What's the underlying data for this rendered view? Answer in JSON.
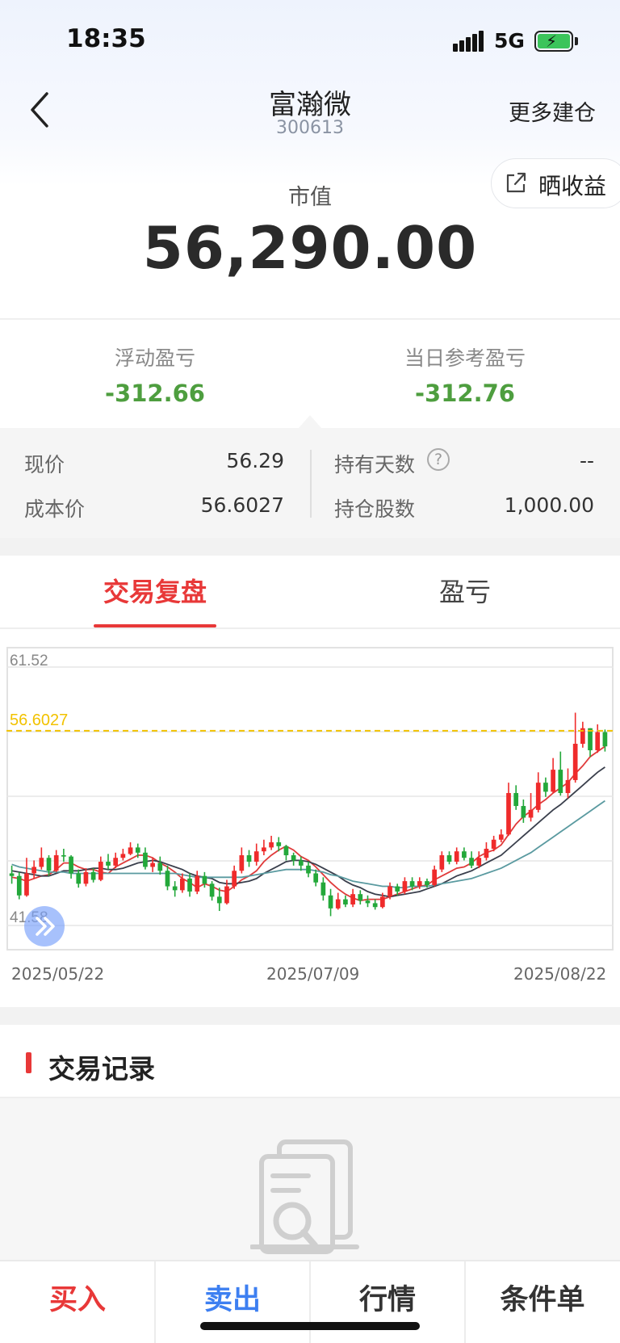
{
  "status_bar": {
    "time": "18:35",
    "network": "5G"
  },
  "nav": {
    "title": "富瀚微",
    "code": "300613",
    "more_label": "更多建仓"
  },
  "share": {
    "label": "晒收益"
  },
  "market_value": {
    "label": "市值",
    "value": "56,290.00"
  },
  "pnl": {
    "floating_label": "浮动盈亏",
    "floating_value": "-312.66",
    "daily_label": "当日参考盈亏",
    "daily_value": "-312.76"
  },
  "details": {
    "current_price_label": "现价",
    "current_price": "56.29",
    "cost_price_label": "成本价",
    "cost_price": "56.6027",
    "holding_days_label": "持有天数",
    "holding_days": "--",
    "shares_label": "持仓股数",
    "shares": "1,000.00"
  },
  "tabs": [
    {
      "label": "交易复盘",
      "active": true
    },
    {
      "label": "盈亏",
      "active": false
    }
  ],
  "chart_data": {
    "type": "candlestick",
    "y_max_label": "61.52",
    "y_min_label": "41.58",
    "ylim": [
      41.58,
      61.52
    ],
    "cost_line": {
      "value": 56.6027,
      "label": "56.6027",
      "color": "#f2c200"
    },
    "x_tick_labels": [
      "2025/05/22",
      "2025/07/09",
      "2025/08/22"
    ],
    "up_color": "#ef2b2b",
    "down_color": "#23a83a",
    "ohlc": [
      [
        45.6,
        45.4,
        46.2,
        44.8
      ],
      [
        45.4,
        43.9,
        45.7,
        43.6
      ],
      [
        43.9,
        45.6,
        46.8,
        43.8
      ],
      [
        45.6,
        46.1,
        46.6,
        45.2
      ],
      [
        46.1,
        46.8,
        47.6,
        45.9
      ],
      [
        46.8,
        45.8,
        47.0,
        45.4
      ],
      [
        45.8,
        47.0,
        47.4,
        45.7
      ],
      [
        47.0,
        46.9,
        47.5,
        46.5
      ],
      [
        46.9,
        45.6,
        47.0,
        45.2
      ],
      [
        45.6,
        44.8,
        45.9,
        44.5
      ],
      [
        44.8,
        45.7,
        46.0,
        44.6
      ],
      [
        45.7,
        45.1,
        46.0,
        44.9
      ],
      [
        45.1,
        46.5,
        46.9,
        45.0
      ],
      [
        46.5,
        46.2,
        47.1,
        45.9
      ],
      [
        46.2,
        46.8,
        47.2,
        46.0
      ],
      [
        46.8,
        47.1,
        47.5,
        46.6
      ],
      [
        47.1,
        47.6,
        48.0,
        47.0
      ],
      [
        47.6,
        47.2,
        47.9,
        46.8
      ],
      [
        47.2,
        46.1,
        47.6,
        45.9
      ],
      [
        46.1,
        46.4,
        46.8,
        45.7
      ],
      [
        46.4,
        45.8,
        46.9,
        45.5
      ],
      [
        45.8,
        44.6,
        46.2,
        44.3
      ],
      [
        44.6,
        44.3,
        45.0,
        43.8
      ],
      [
        44.3,
        45.2,
        45.6,
        44.1
      ],
      [
        45.2,
        44.2,
        45.6,
        43.8
      ],
      [
        44.2,
        45.4,
        45.8,
        44.0
      ],
      [
        45.4,
        44.8,
        45.7,
        44.5
      ],
      [
        44.8,
        43.8,
        45.0,
        43.5
      ],
      [
        43.8,
        43.3,
        44.5,
        42.7
      ],
      [
        43.3,
        44.6,
        45.1,
        43.2
      ],
      [
        44.6,
        45.8,
        46.2,
        44.4
      ],
      [
        45.8,
        47.0,
        47.6,
        45.6
      ],
      [
        47.0,
        46.5,
        47.4,
        46.1
      ],
      [
        46.5,
        47.3,
        47.9,
        46.2
      ],
      [
        47.3,
        47.6,
        48.2,
        47.0
      ],
      [
        47.6,
        48.0,
        48.5,
        47.4
      ],
      [
        48.0,
        47.7,
        48.4,
        47.3
      ],
      [
        47.7,
        47.0,
        47.8,
        46.6
      ],
      [
        47.0,
        46.6,
        47.2,
        46.2
      ],
      [
        46.6,
        46.2,
        46.9,
        45.8
      ],
      [
        46.2,
        45.6,
        46.5,
        45.3
      ],
      [
        45.6,
        44.9,
        45.9,
        44.6
      ],
      [
        44.9,
        43.9,
        45.3,
        43.5
      ],
      [
        43.9,
        42.9,
        44.4,
        42.3
      ],
      [
        42.9,
        43.6,
        44.1,
        42.8
      ],
      [
        43.6,
        43.2,
        43.9,
        43.0
      ],
      [
        43.2,
        44.0,
        44.4,
        43.0
      ],
      [
        44.0,
        43.5,
        44.3,
        43.2
      ],
      [
        43.5,
        43.3,
        43.9,
        43.0
      ],
      [
        43.3,
        43.0,
        43.6,
        42.8
      ],
      [
        43.0,
        43.8,
        44.1,
        42.9
      ],
      [
        43.8,
        44.6,
        44.9,
        43.6
      ],
      [
        44.6,
        44.2,
        44.8,
        43.9
      ],
      [
        44.2,
        45.0,
        45.3,
        44.0
      ],
      [
        45.0,
        44.6,
        45.3,
        44.3
      ],
      [
        44.6,
        45.0,
        45.3,
        44.4
      ],
      [
        45.0,
        44.7,
        45.2,
        44.5
      ],
      [
        44.7,
        45.9,
        46.2,
        44.6
      ],
      [
        45.9,
        47.0,
        47.3,
        45.7
      ],
      [
        47.0,
        46.5,
        47.3,
        46.3
      ],
      [
        46.5,
        47.3,
        47.6,
        46.3
      ],
      [
        47.3,
        46.8,
        47.6,
        46.6
      ],
      [
        46.8,
        46.2,
        47.3,
        46.0
      ],
      [
        46.2,
        46.8,
        47.3,
        46.0
      ],
      [
        46.8,
        47.5,
        48.0,
        46.6
      ],
      [
        47.5,
        48.2,
        48.5,
        47.3
      ],
      [
        48.2,
        48.6,
        49.0,
        48.0
      ],
      [
        48.6,
        51.8,
        52.6,
        48.5
      ],
      [
        51.8,
        50.8,
        52.4,
        50.5
      ],
      [
        50.8,
        49.9,
        51.3,
        49.5
      ],
      [
        49.9,
        50.5,
        51.8,
        49.6
      ],
      [
        50.5,
        52.6,
        53.4,
        50.3
      ],
      [
        52.6,
        51.9,
        53.0,
        51.5
      ],
      [
        51.9,
        53.6,
        54.5,
        51.8
      ],
      [
        53.6,
        51.8,
        55.0,
        51.6
      ],
      [
        51.8,
        52.8,
        53.7,
        51.4
      ],
      [
        52.8,
        55.6,
        58.0,
        52.6
      ],
      [
        55.6,
        56.8,
        57.3,
        55.3
      ],
      [
        56.8,
        55.1,
        56.8,
        54.6
      ],
      [
        55.1,
        56.5,
        57.1,
        54.9
      ],
      [
        56.5,
        55.4,
        56.7,
        55.0
      ]
    ],
    "ma": [
      {
        "color": "#e03b3b",
        "values": [
          45.3,
          45.2,
          45.0,
          45.2,
          45.4,
          45.5,
          45.9,
          46.4,
          46.4,
          46.1,
          45.9,
          45.9,
          45.7,
          45.6,
          46.1,
          46.4,
          46.7,
          47.0,
          47.0,
          46.8,
          46.4,
          46.1,
          45.7,
          45.2,
          44.9,
          44.5,
          44.8,
          44.6,
          44.3,
          44.2,
          44.6,
          45.1,
          45.4,
          45.8,
          46.5,
          47.0,
          47.4,
          47.7,
          47.4,
          46.9,
          46.6,
          46.1,
          45.5,
          44.9,
          44.4,
          44.0,
          43.7,
          43.5,
          43.6,
          43.6,
          43.6,
          43.8,
          44.0,
          44.2,
          44.4,
          44.6,
          44.7,
          45.1,
          45.4,
          45.7,
          46.0,
          46.1,
          46.4,
          46.9,
          47.2,
          47.4,
          47.8,
          48.6,
          49.4,
          50.0,
          50.4,
          50.9,
          51.3,
          51.8,
          52.2,
          52.6,
          53.3,
          53.9,
          54.6,
          55.0,
          55.4
        ]
      },
      {
        "color": "#3a3f4c",
        "values": [
          45.8,
          45.7,
          45.6,
          45.5,
          45.4,
          45.4,
          45.6,
          45.8,
          45.8,
          45.8,
          45.9,
          46.0,
          46.0,
          45.9,
          45.9,
          46.0,
          46.2,
          46.4,
          46.5,
          46.6,
          46.5,
          46.3,
          46.1,
          45.9,
          45.6,
          45.4,
          45.3,
          45.2,
          44.9,
          44.8,
          44.8,
          44.9,
          45.0,
          45.2,
          45.6,
          45.9,
          46.2,
          46.5,
          46.6,
          46.6,
          46.5,
          46.3,
          46.0,
          45.7,
          45.4,
          45.0,
          44.7,
          44.5,
          44.2,
          44.0,
          43.9,
          43.8,
          43.9,
          44.0,
          44.1,
          44.2,
          44.4,
          44.6,
          44.8,
          45.1,
          45.4,
          45.6,
          45.8,
          46.1,
          46.4,
          46.7,
          47.0,
          47.5,
          48.0,
          48.5,
          49.0,
          49.5,
          50.0,
          50.5,
          50.9,
          51.4,
          51.9,
          52.4,
          52.9,
          53.4,
          53.8
        ]
      },
      {
        "color": "#5a9aa0",
        "values": [
          46.3,
          46.1,
          46.0,
          45.9,
          45.8,
          45.7,
          45.7,
          45.7,
          45.6,
          45.6,
          45.6,
          45.6,
          45.6,
          45.6,
          45.6,
          45.6,
          45.6,
          45.6,
          45.6,
          45.6,
          45.6,
          45.6,
          45.6,
          45.5,
          45.4,
          45.3,
          45.3,
          45.3,
          45.3,
          45.3,
          45.3,
          45.3,
          45.4,
          45.5,
          45.6,
          45.7,
          45.8,
          45.9,
          45.9,
          45.9,
          45.9,
          45.8,
          45.7,
          45.5,
          45.4,
          45.2,
          45.0,
          44.9,
          44.8,
          44.7,
          44.6,
          44.6,
          44.5,
          44.5,
          44.6,
          44.6,
          44.6,
          44.7,
          44.8,
          44.9,
          45.0,
          45.1,
          45.2,
          45.4,
          45.6,
          45.8,
          46.0,
          46.3,
          46.6,
          46.9,
          47.2,
          47.6,
          48.0,
          48.4,
          48.8,
          49.2,
          49.6,
          50.0,
          50.4,
          50.8,
          51.2
        ]
      }
    ]
  },
  "trade_records": {
    "title": "交易记录"
  },
  "bottom_bar": [
    {
      "label": "买入",
      "color": "#e83838"
    },
    {
      "label": "卖出",
      "color": "#3d7ff1"
    },
    {
      "label": "行情",
      "color": "#333333"
    },
    {
      "label": "条件单",
      "color": "#333333"
    }
  ]
}
